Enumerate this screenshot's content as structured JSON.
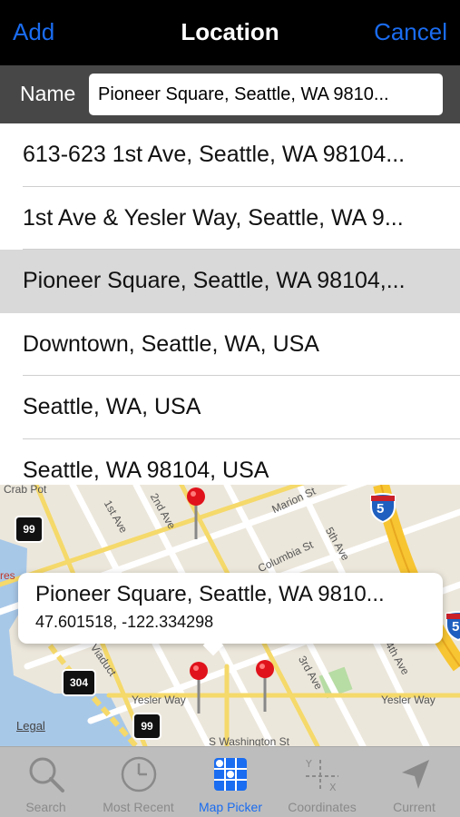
{
  "nav": {
    "add_label": "Add",
    "title": "Location",
    "cancel_label": "Cancel"
  },
  "name_field": {
    "label": "Name",
    "value": "Pioneer Square, Seattle, WA 9810..."
  },
  "results": [
    {
      "text": "613-623 1st Ave, Seattle, WA 98104...",
      "selected": false
    },
    {
      "text": "1st Ave & Yesler Way, Seattle, WA 9...",
      "selected": false
    },
    {
      "text": "Pioneer Square, Seattle, WA 98104,...",
      "selected": true
    },
    {
      "text": "Downtown, Seattle, WA, USA",
      "selected": false
    },
    {
      "text": "Seattle, WA, USA",
      "selected": false
    },
    {
      "text": "Seattle, WA 98104, USA",
      "selected": false
    }
  ],
  "map": {
    "labels": {
      "crab_pot": "Crab Pot",
      "first_ave": "1st Ave",
      "second_ave": "2nd Ave",
      "marion_st": "Marion St",
      "fifth_ave": "5th Ave",
      "columbia_st": "Columbia St",
      "third_ave": "3rd Ave",
      "viaduct": "Viaduct",
      "yesler_way_left": "Yesler Way",
      "yesler_way_right": "Yesler Way",
      "washington_st": "S Washington St",
      "fourth_ave": "4th Ave",
      "restaurant": "res"
    },
    "shields": {
      "sr99_top": "99",
      "sr304": "304",
      "sr99_bottom": "99",
      "i5": "5",
      "i5_edge": "5"
    },
    "legal_label": "Legal",
    "callout": {
      "title": "Pioneer Square, Seattle, WA 9810...",
      "coords": "47.601518, -122.334298"
    }
  },
  "tabs": [
    {
      "label": "Search",
      "icon": "search-icon",
      "active": false
    },
    {
      "label": "Most Recent",
      "icon": "clock-icon",
      "active": false
    },
    {
      "label": "Map Picker",
      "icon": "map-picker-icon",
      "active": true
    },
    {
      "label": "Coordinates",
      "icon": "coordinates-icon",
      "active": false
    },
    {
      "label": "Current",
      "icon": "location-arrow-icon",
      "active": false
    }
  ],
  "colors": {
    "accent": "#1a6cf0",
    "nav_bg": "#000000",
    "name_row_bg": "#474747",
    "selected_row_bg": "#d9d9d9",
    "tab_bar_bg": "#bdbdbd",
    "pin_red": "#e0121b",
    "freeway_yellow": "#f7d44a",
    "water_blue": "#a8c8e8"
  }
}
